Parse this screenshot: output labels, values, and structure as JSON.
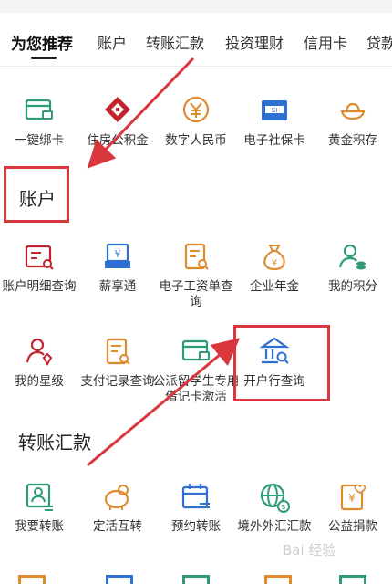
{
  "tabs": [
    "为您推荐",
    "账户",
    "转账汇款",
    "投资理财",
    "信用卡",
    "贷款"
  ],
  "row1": [
    "一键绑卡",
    "住房公积金",
    "数字人民币",
    "电子社保卡",
    "黄金积存"
  ],
  "sections": {
    "account": "账户",
    "transfer": "转账汇款"
  },
  "account_row1": [
    "账户明细查询",
    "薪享通",
    "电子工资单查询",
    "企业年金",
    "我的积分"
  ],
  "account_row2": [
    "我的星级",
    "支付记录查询",
    "公派留学生专用借记卡激活",
    "开户行查询"
  ],
  "transfer_row1": [
    "我要转账",
    "定活互转",
    "预约转账",
    "境外外汇汇款",
    "公益捐款"
  ],
  "watermark": "Bai 经验",
  "colors": {
    "green": "#2e9a78",
    "blue": "#2f6fd1",
    "orange": "#e08a2e",
    "red": "#c2242d",
    "annotation": "#d9363e"
  }
}
